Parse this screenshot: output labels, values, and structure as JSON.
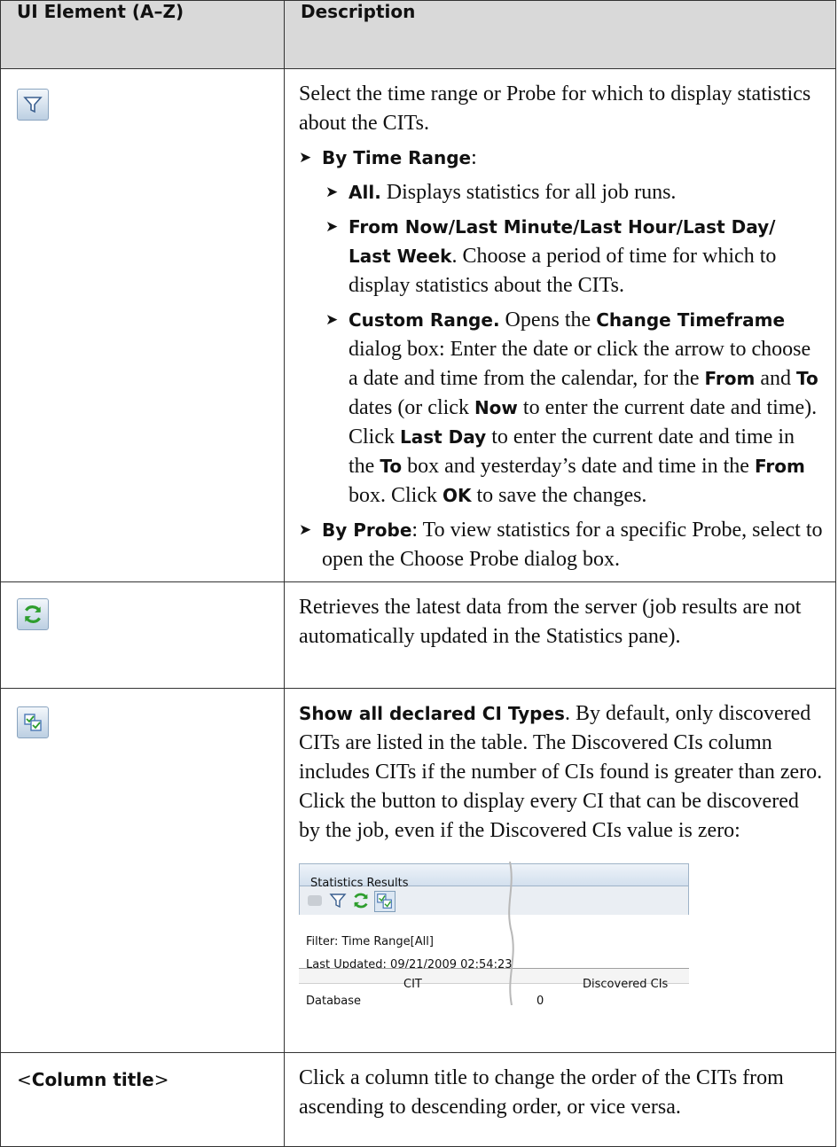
{
  "table": {
    "headers": [
      "UI Element (A–Z)",
      "Description"
    ],
    "row_filter": {
      "icon": "filter-funnel-icon",
      "intro": "Select the time range or Probe for which to display statistics about the CITs.",
      "by_time_range_label": "By Time Range",
      "by_time_range_colon": ":",
      "all_label": "All.",
      "all_text": " Displays statistics for all job runs.",
      "periods_label": "From Now/Last Minute/Last Hour/Last Day/ Last Week",
      "periods_text": ". Choose a period of time for which to display statistics about the CITs.",
      "custom": {
        "label": "Custom Range.",
        "t1": " Opens the ",
        "b1": "Change Timeframe",
        "t2": " dialog box: Enter the date or click the arrow to choose a date and time from the calendar, for the ",
        "b2": "From",
        "t3": " and ",
        "b3": "To",
        "t4": " dates (or click ",
        "b4": "Now",
        "t5": " to enter the current date and time). Click ",
        "b5": "Last Day",
        "t6": " to enter the current date and time in the ",
        "b6": "To",
        "t7": " box and yesterday’s date and time in the ",
        "b7": "From",
        "t8": " box. Click ",
        "b8": "OK",
        "t9": " to save the changes."
      },
      "by_probe_label": "By Probe",
      "by_probe_text": ": To view statistics for a specific Probe, select to open the Choose Probe dialog box."
    },
    "row_refresh": {
      "icon": "refresh-icon",
      "text": "Retrieves the latest data from the server (job results are not automatically updated in the Statistics pane)."
    },
    "row_show_all": {
      "icon": "show-all-declared-icon",
      "label": "Show all declared CI Types",
      "text": ". By default, only discovered CITs are listed in the table. The Discovered CIs column includes CITs if the number of CIs found is greater than zero. Click the button to display every CI that can be discovered by the job, even if the Discovered CIs value is zero:",
      "screenshot": {
        "title": "Statistics Results",
        "filter": "Filter: Time Range[All]",
        "last_updated": "Last Updated: 09/21/2009 02:54:23",
        "col_cit": "CIT",
        "col_discovered": "Discovered CIs",
        "row_cit": "Database",
        "row_value": "0"
      }
    },
    "row_column_title": {
      "lt": "<",
      "label": "Column title",
      "gt": ">",
      "text": "Click a column title to change the order of the CITs from ascending to descending order, or vice versa."
    }
  },
  "bullet_glyph": "➤",
  "colors": {
    "header_bg": "#d9d9d9",
    "border": "#333333",
    "icon_green": "#2e9e2e",
    "icon_blue": "#4a78b5"
  }
}
